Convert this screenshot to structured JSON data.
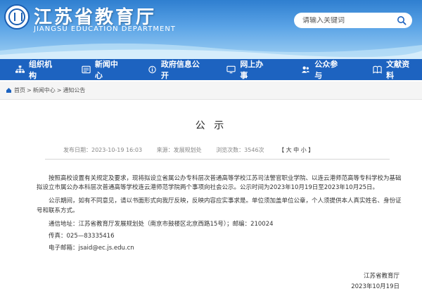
{
  "header": {
    "title": "江苏省教育厅",
    "subtitle": "JIANGSU EDUCATION DEPARTMENT",
    "search_placeholder": "请输入关键词"
  },
  "nav": {
    "items": [
      {
        "label": "组织机构",
        "icon": "org-icon"
      },
      {
        "label": "新闻中心",
        "icon": "news-icon"
      },
      {
        "label": "政府信息公开",
        "icon": "info-icon"
      },
      {
        "label": "网上办事",
        "icon": "monitor-icon"
      },
      {
        "label": "公众参与",
        "icon": "people-icon"
      },
      {
        "label": "文献资料",
        "icon": "book-icon"
      }
    ]
  },
  "breadcrumb": {
    "home": "首页",
    "sep": ">",
    "news": "新闻中心",
    "notice": "通知公告"
  },
  "article": {
    "title": "公 示",
    "publish_time": "发布日期：2023-10-19 16:03",
    "source": "来源：发展规划处",
    "views": "浏览次数：3546次",
    "font_size": "【 大 中 小 】",
    "para1": "按照高校设置有关规定及要求，现将拟设立省属公办专科层次普通高等学校江苏司法警官职业学院、以连云港师范高等专科学校为基础拟设立市属公办本科层次普通高等学校连云港师范学院两个事项向社会公示。公示时间为2023年10月19日至2023年10月25日。",
    "para2": "公示期间，如有不同意见，请以书面形式向我厅反映，反映内容应实事求是。单位须加盖单位公章，个人须提供本人真实姓名、身份证号和联系方式。",
    "address": "通信地址：江苏省教育厅发展规划处（南京市鼓楼区北京西路15号）；邮编：210024",
    "fax": "传真：025—83335416",
    "email": "电子邮箱：jsaid@ec.js.edu.cn",
    "signer": "江苏省教育厅",
    "date": "2023年10月19日"
  }
}
